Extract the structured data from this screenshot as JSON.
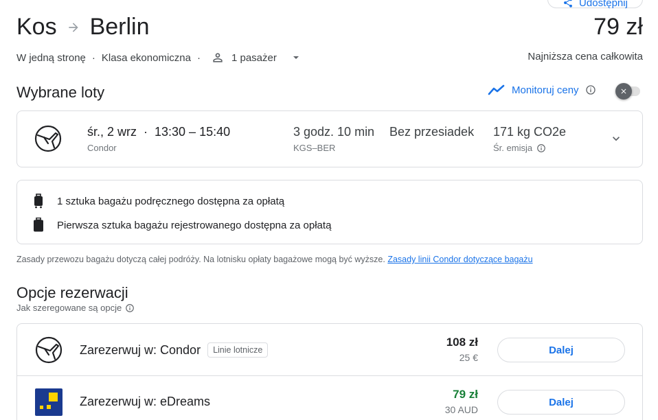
{
  "header": {
    "share_label": "Udostępnij",
    "origin": "Kos",
    "destination": "Berlin",
    "price": "79 zł",
    "trip_type": "W jedną stronę",
    "cabin_class": "Klasa ekonomiczna",
    "passengers": "1 pasażer",
    "price_note": "Najniższa cena całkowita"
  },
  "selected": {
    "title": "Wybrane loty",
    "monitor_label": "Monitoruj ceny",
    "monitor_enabled": false
  },
  "flight": {
    "date_time": "śr., 2 wrz  ·  13:30 – 15:40",
    "airline": "Condor",
    "duration": "3 godz. 10 min",
    "airports": "KGS–BER",
    "stops": "Bez przesiadek",
    "emissions": "171 kg CO2e",
    "emissions_label": "Śr. emisja"
  },
  "baggage": {
    "carry_on": "1 sztuka bagażu podręcznego dostępna za opłatą",
    "checked": "Pierwsza sztuka bagażu rejestrowanego dostępna za opłatą",
    "policy_text": "Zasady przewozu bagażu dotyczą całej podróży. Na lotnisku opłaty bagażowe mogą być wyższe.",
    "policy_link": "Zasady linii Condor dotyczące bagażu"
  },
  "booking": {
    "title": "Opcje rezerwacji",
    "ranking_note": "Jak szeregowane są opcje",
    "options": [
      {
        "name": "Zarezerwuj w: Condor",
        "badge": "Linie lotnicze",
        "price": "108 zł",
        "price_alt": "25 €",
        "button": "Dalej"
      },
      {
        "name": "Zarezerwuj w: eDreams",
        "price": "79 zł",
        "price_alt": "30 AUD",
        "button": "Dalej"
      }
    ]
  },
  "colors": {
    "accent": "#1a73e8",
    "green_price": "#188038",
    "edreams_blue": "#1a3a8f",
    "edreams_yellow": "#ffd200"
  }
}
